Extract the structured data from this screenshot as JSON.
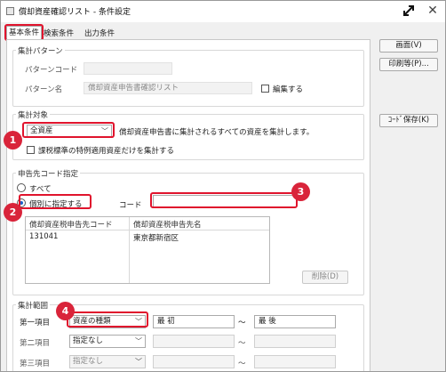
{
  "window": {
    "title": "償却資産確認リスト - 条件設定"
  },
  "tabs": [
    {
      "label": "基本条件"
    },
    {
      "label": "検索条件"
    },
    {
      "label": "出力条件"
    }
  ],
  "side_buttons": {
    "preview": "画面(V)",
    "print": "印刷等(P)...",
    "code_save": "ｺｰﾄﾞ保存(K)"
  },
  "pattern": {
    "group_label": "集計パターン",
    "code_label": "パターンコード",
    "code_value": "",
    "name_label": "パターン名",
    "name_value": "償却資産申告書確認リスト",
    "edit_label": "編集する"
  },
  "target": {
    "group_label": "集計対象",
    "select_value": "全資産",
    "description": "償却資産申告書に集計されるすべての資産を集計します。",
    "taxation_label": "課税標準の特例適用資産だけを集計する"
  },
  "filing": {
    "group_label": "申告先コード指定",
    "all_label": "すべて",
    "individual_label": "個別に指定する",
    "code_label": "コード",
    "code_value": "",
    "list_headers": [
      "償却資産税申告先コード",
      "償却資産税申告先名"
    ],
    "list_rows": [
      {
        "code": "131041",
        "name": "東京都新宿区"
      }
    ],
    "delete_label": "削除(D)"
  },
  "range": {
    "group_label": "集計範囲",
    "tilde": "～",
    "rows": [
      {
        "label": "第一項目",
        "select": "資産の種類",
        "from": "最 初",
        "to": "最 後"
      },
      {
        "label": "第二項目",
        "select": "指定なし",
        "from": "",
        "to": ""
      },
      {
        "label": "第三項目",
        "select": "指定なし",
        "from": "",
        "to": ""
      }
    ]
  },
  "callouts": [
    "1",
    "2",
    "3",
    "4"
  ],
  "colors": {
    "callout": "#d9243a",
    "highlight": "#e0142d",
    "radio_dot": "#1a5fc8"
  },
  "icons": {
    "expand": "expand-arrows-icon",
    "close": "close-icon",
    "dropdown": "chevron-down-icon"
  }
}
